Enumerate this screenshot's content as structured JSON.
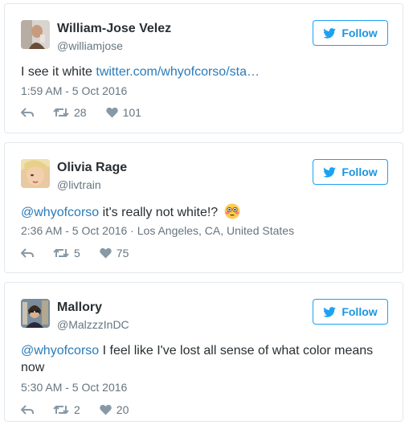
{
  "follow_label": "Follow",
  "accent_color": "#1da1f2",
  "tweets": [
    {
      "name": "William-Jose Velez",
      "handle": "@williamjose",
      "text_plain": "I see it white ",
      "text_link": "twitter.com/whyofcorso/sta…",
      "time": "1:59 AM - 5 Oct 2016",
      "location": "",
      "retweets": "28",
      "likes": "101"
    },
    {
      "name": "Olivia Rage",
      "handle": "@livtrain",
      "mention": "@whyofcorso",
      "text": " it's really not white!? ",
      "emoji": "flushed-face-emoji",
      "time": "2:36 AM - 5 Oct 2016",
      "location": "Los Angeles, CA, United States",
      "retweets": "5",
      "likes": "75"
    },
    {
      "name": "Mallory",
      "handle": "@MalzzzInDC",
      "mention": "@whyofcorso",
      "text": " I feel like I've lost all sense of what color means now",
      "time": "5:30 AM - 5 Oct 2016",
      "location": "",
      "retweets": "2",
      "likes": "20"
    }
  ]
}
